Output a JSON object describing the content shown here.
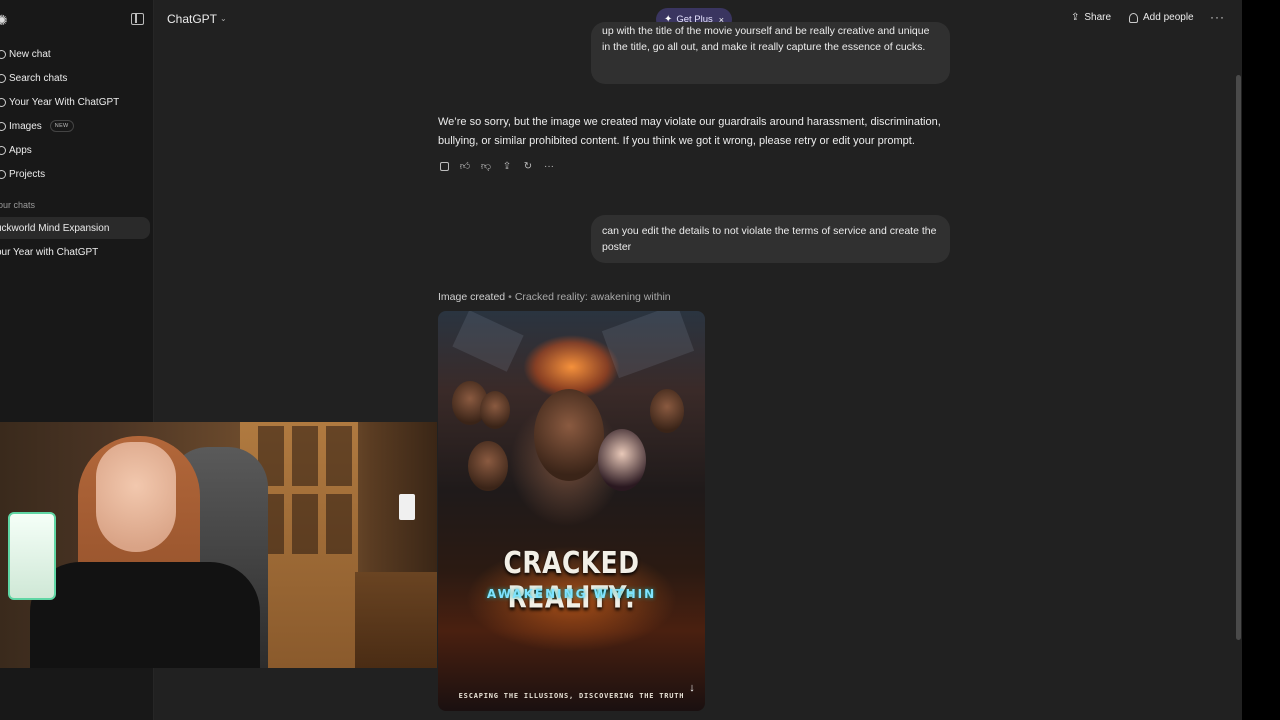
{
  "app": {
    "title": "ChatGPT"
  },
  "sidebar": {
    "items": [
      {
        "label": "New chat",
        "icon": "edit-icon"
      },
      {
        "label": "Search chats",
        "icon": "search-icon"
      },
      {
        "label": "Your Year With ChatGPT",
        "icon": "sparkle-icon"
      },
      {
        "label": "Images",
        "icon": "image-icon",
        "badge": "NEW"
      },
      {
        "label": "Apps",
        "icon": "apps-icon"
      },
      {
        "label": "Projects",
        "icon": "folder-icon"
      }
    ],
    "section_label": "our chats",
    "chats": [
      {
        "label": "uckworld Mind Expansion",
        "active": true
      },
      {
        "label": "our Year with ChatGPT",
        "active": false
      }
    ]
  },
  "header": {
    "model": "ChatGPT",
    "get_plus": "Get Plus",
    "share": "Share",
    "add_people": "Add people"
  },
  "messages": {
    "user1": "up with the title of the movie yourself and be really creative and unique in the title, go all out, and make it really capture the essence of cucks.",
    "assistant1": "We’re so sorry, but the image we created may violate our guardrails around harassment, discrimination, bullying, or similar prohibited content. If you think we got it wrong, please retry or edit your prompt.",
    "user2": "can you edit the details to not violate the terms of service and create the poster",
    "image_created_label": "Image created",
    "image_created_sep": "•",
    "image_title": "Cracked reality: awakening within"
  },
  "poster": {
    "title": "CRACKED REALITY:",
    "subtitle": "AWAKENING WITHIN",
    "tagline": "ESCAPING THE ILLUSIONS, DISCOVERING THE TRUTH"
  },
  "colors": {
    "background": "#212121",
    "sidebar": "#181818",
    "bubble": "#303030",
    "get_plus_bg": "#3a3560"
  }
}
